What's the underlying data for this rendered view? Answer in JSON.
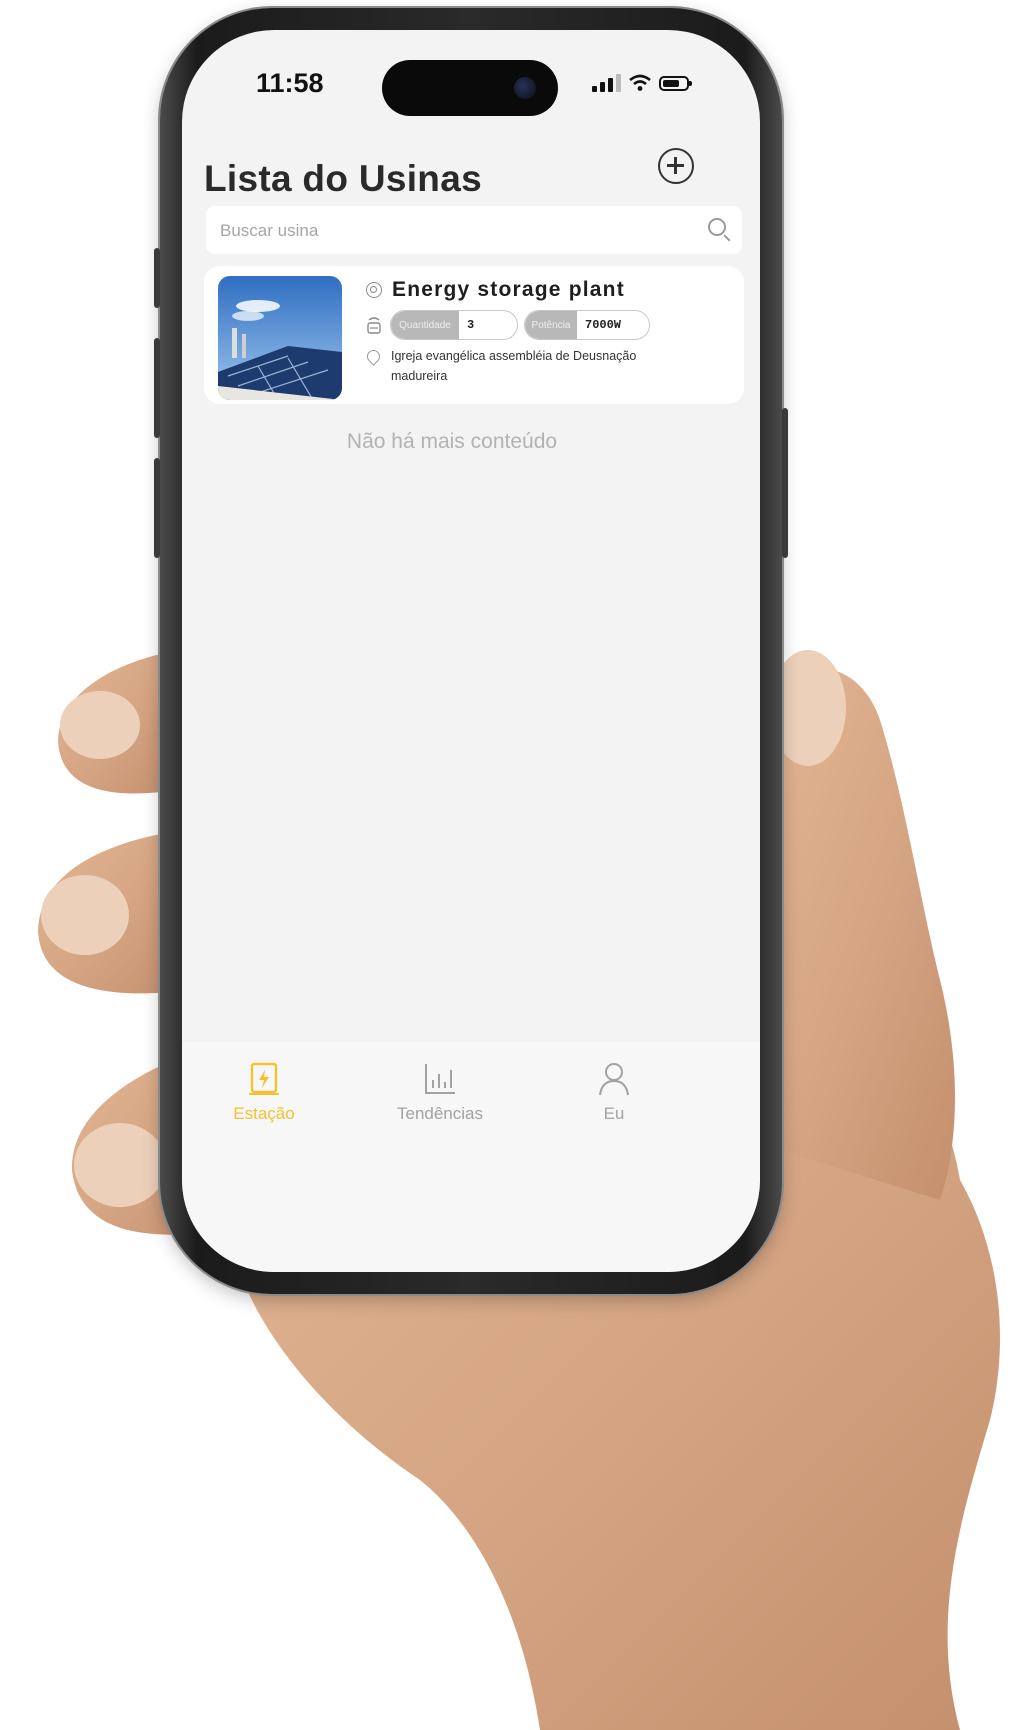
{
  "status_bar": {
    "time": "11:58"
  },
  "header": {
    "title": "Lista do Usinas",
    "add_icon": "plus-circle-icon"
  },
  "search": {
    "placeholder": "Buscar usina",
    "icon": "search-icon"
  },
  "plants": [
    {
      "name": "Energy storage plant",
      "quantity_label": "Quantidade",
      "quantity_value": "3",
      "power_label": "Potência",
      "power_value": "7000W",
      "address": "Igreja evangélica assembléia de Deusnação madureira"
    }
  ],
  "list_footer": "Não há mais conteúdo",
  "tabbar": {
    "items": [
      {
        "label": "Estação",
        "icon": "station-icon",
        "active": true
      },
      {
        "label": "Tendências",
        "icon": "chart-icon",
        "active": false
      },
      {
        "label": "Eu",
        "icon": "user-icon",
        "active": false
      }
    ]
  },
  "colors": {
    "accent": "#f2c230",
    "background": "#f3f3f3",
    "inactive": "#a2a2a2"
  }
}
